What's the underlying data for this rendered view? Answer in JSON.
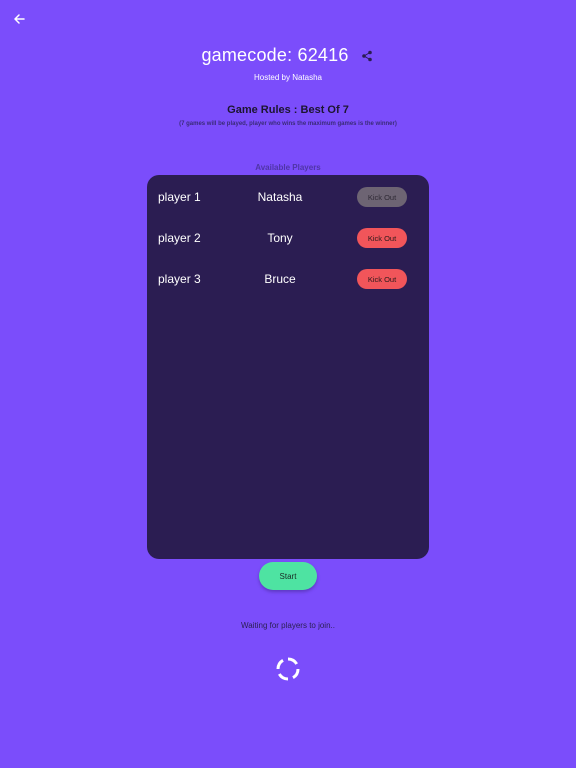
{
  "header": {
    "back_icon": "arrow-left-icon",
    "title": "gamecode: 62416",
    "share_icon": "share-icon",
    "host": "Hosted by Natasha"
  },
  "rules": {
    "title": "Game Rules : Best Of 7",
    "subtitle": "(7 games will be played, player who wins the maximum games is the winner)"
  },
  "players": {
    "heading": "Available Players",
    "items": [
      {
        "index": "player 1",
        "name": "Natasha",
        "action": "Kick Out",
        "enabled": false
      },
      {
        "index": "player 2",
        "name": "Tony",
        "action": "Kick Out",
        "enabled": true
      },
      {
        "index": "player 3",
        "name": "Bruce",
        "action": "Kick Out",
        "enabled": true
      }
    ]
  },
  "footer": {
    "start_label": "Start",
    "status": "Waiting for players to join..",
    "loading_icon": "spinner-icon"
  },
  "colors": {
    "background": "#7b4dfb",
    "panel": "#2b1d52",
    "kick_active": "#f1555a",
    "kick_disabled": "#6d6473",
    "start": "#4ee3a2"
  }
}
